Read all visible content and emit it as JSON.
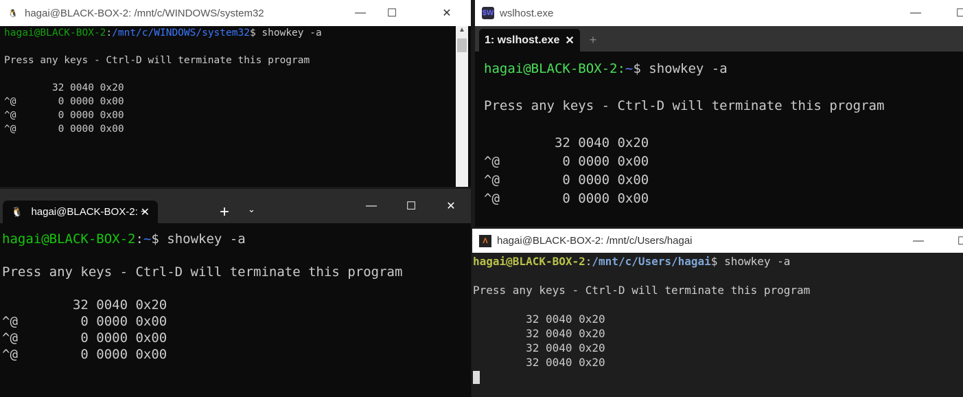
{
  "w1": {
    "title": "hagai@BLACK-BOX-2: /mnt/c/WINDOWS/system32",
    "user": "hagai@BLACK-BOX-2",
    "path": "/mnt/c/WINDOWS/system32",
    "cmd": "$ showkey -a",
    "msg": "Press any keys - Ctrl-D will terminate this program",
    "rows": [
      "        32 0040 0x20",
      "^@       0 0000 0x00",
      "^@       0 0000 0x00",
      "^@       0 0000 0x00"
    ],
    "colors": {
      "user": "#13a10e",
      "path": "#3b78ff"
    }
  },
  "w2": {
    "title": "wslhost.exe",
    "icon": "$W",
    "tab": "1: wslhost.exe",
    "user": "hagai@BLACK-BOX-2",
    "path": "~",
    "cmd": "$ showkey -a",
    "msg": "Press any keys - Ctrl-D will terminate this program",
    "rows": [
      "         32 0040 0x20",
      "^@        0 0000 0x00",
      "^@        0 0000 0x00",
      "^@        0 0000 0x00"
    ],
    "colors": {
      "user": "#4ae05a",
      "path": "#5c7cfa"
    }
  },
  "w3": {
    "tab": "hagai@BLACK-BOX-2: ~",
    "user": "hagai@BLACK-BOX-2",
    "path": "~",
    "cmd": "$ showkey -a",
    "msg": "Press any keys - Ctrl-D will terminate this program",
    "rows": [
      "         32 0040 0x20",
      "^@        0 0000 0x00",
      "^@        0 0000 0x00",
      "^@        0 0000 0x00"
    ],
    "colors": {
      "user": "#16c60c",
      "path": "#3b78ff"
    }
  },
  "w4": {
    "title": "hagai@BLACK-BOX-2: /mnt/c/Users/hagai",
    "user": "hagai@BLACK-BOX-2",
    "path": "/mnt/c/Users/hagai",
    "cmd": "$ showkey -a",
    "msg": "Press any keys - Ctrl-D will terminate this program",
    "rows": [
      "        32 0040 0x20",
      "        32 0040 0x20",
      "        32 0040 0x20",
      "        32 0040 0x20"
    ],
    "colors": {
      "user": "#b9c24a",
      "path": "#7fa6d8"
    }
  }
}
